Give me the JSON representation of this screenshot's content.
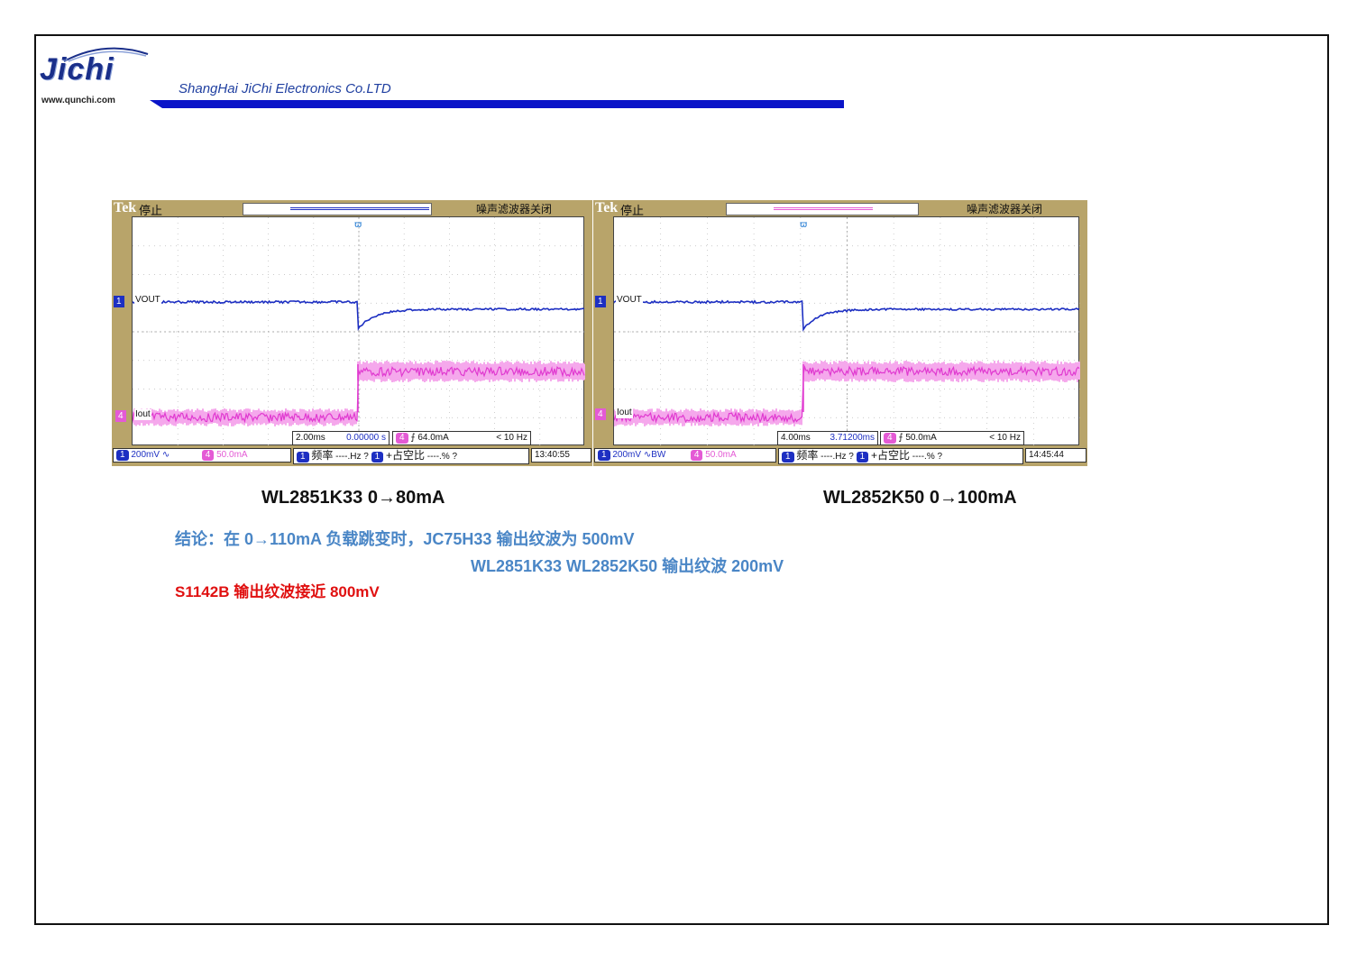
{
  "header": {
    "logo_text": "Jichi",
    "logo_url": "www.qunchi.com",
    "company": "ShangHai JiChi Electronics Co.LTD"
  },
  "scopes": [
    {
      "brand": "Tek",
      "state": "停止",
      "filter": "噪声滤波器关闭",
      "ch1_label": "VOUT",
      "ch4_label": "Iout",
      "ch1_num": "1",
      "ch4_num": "4",
      "timebase": "2.00ms",
      "trig_pos": "0.00000 s",
      "trig_level": "64.0mA",
      "freq_limit": "< 10 Hz",
      "ch1_scale": "200mV",
      "ch1_coupling": "∿",
      "ch4_scale": "50.0mA",
      "freq_label": "频率",
      "freq_value": "----.Hz",
      "duty_label": "+占空比",
      "duty_value": "----.%",
      "time": "13:40:55",
      "caption": "WL2851K33    0→80mA"
    },
    {
      "brand": "Tek",
      "state": "停止",
      "filter": "噪声滤波器关闭",
      "ch1_label": "VOUT",
      "ch4_label": "Iout",
      "ch1_num": "1",
      "ch4_num": "4",
      "timebase": "4.00ms",
      "trig_pos": "3.71200ms",
      "trig_level": "50.0mA",
      "freq_limit": "< 10 Hz",
      "ch1_scale": "200mV",
      "ch1_coupling": "∿BW",
      "ch4_scale": "50.0mA",
      "freq_label": "频率",
      "freq_value": "----.Hz",
      "duty_label": "+占空比",
      "duty_value": "----.%",
      "time": "14:45:44",
      "caption": "WL2852K50    0→100mA"
    }
  ],
  "conclusion": {
    "line1": "结论：在 0→110mA 负载跳变时，JC75H33 输出纹波为 500mV",
    "line2": "WL2851K33    WL2852K50 输出纹波 200mV",
    "line3": "S1142B 输出纹波接近 800mV"
  },
  "colors": {
    "frame": "#111111",
    "brand_blue": "#1f3fa0",
    "conclusion_blue": "#4a86c6",
    "conclusion_red": "#e01010",
    "ch1": "#1d2fc2",
    "ch4": "#e03ad0",
    "scope_bezel": "#b8a46a"
  }
}
